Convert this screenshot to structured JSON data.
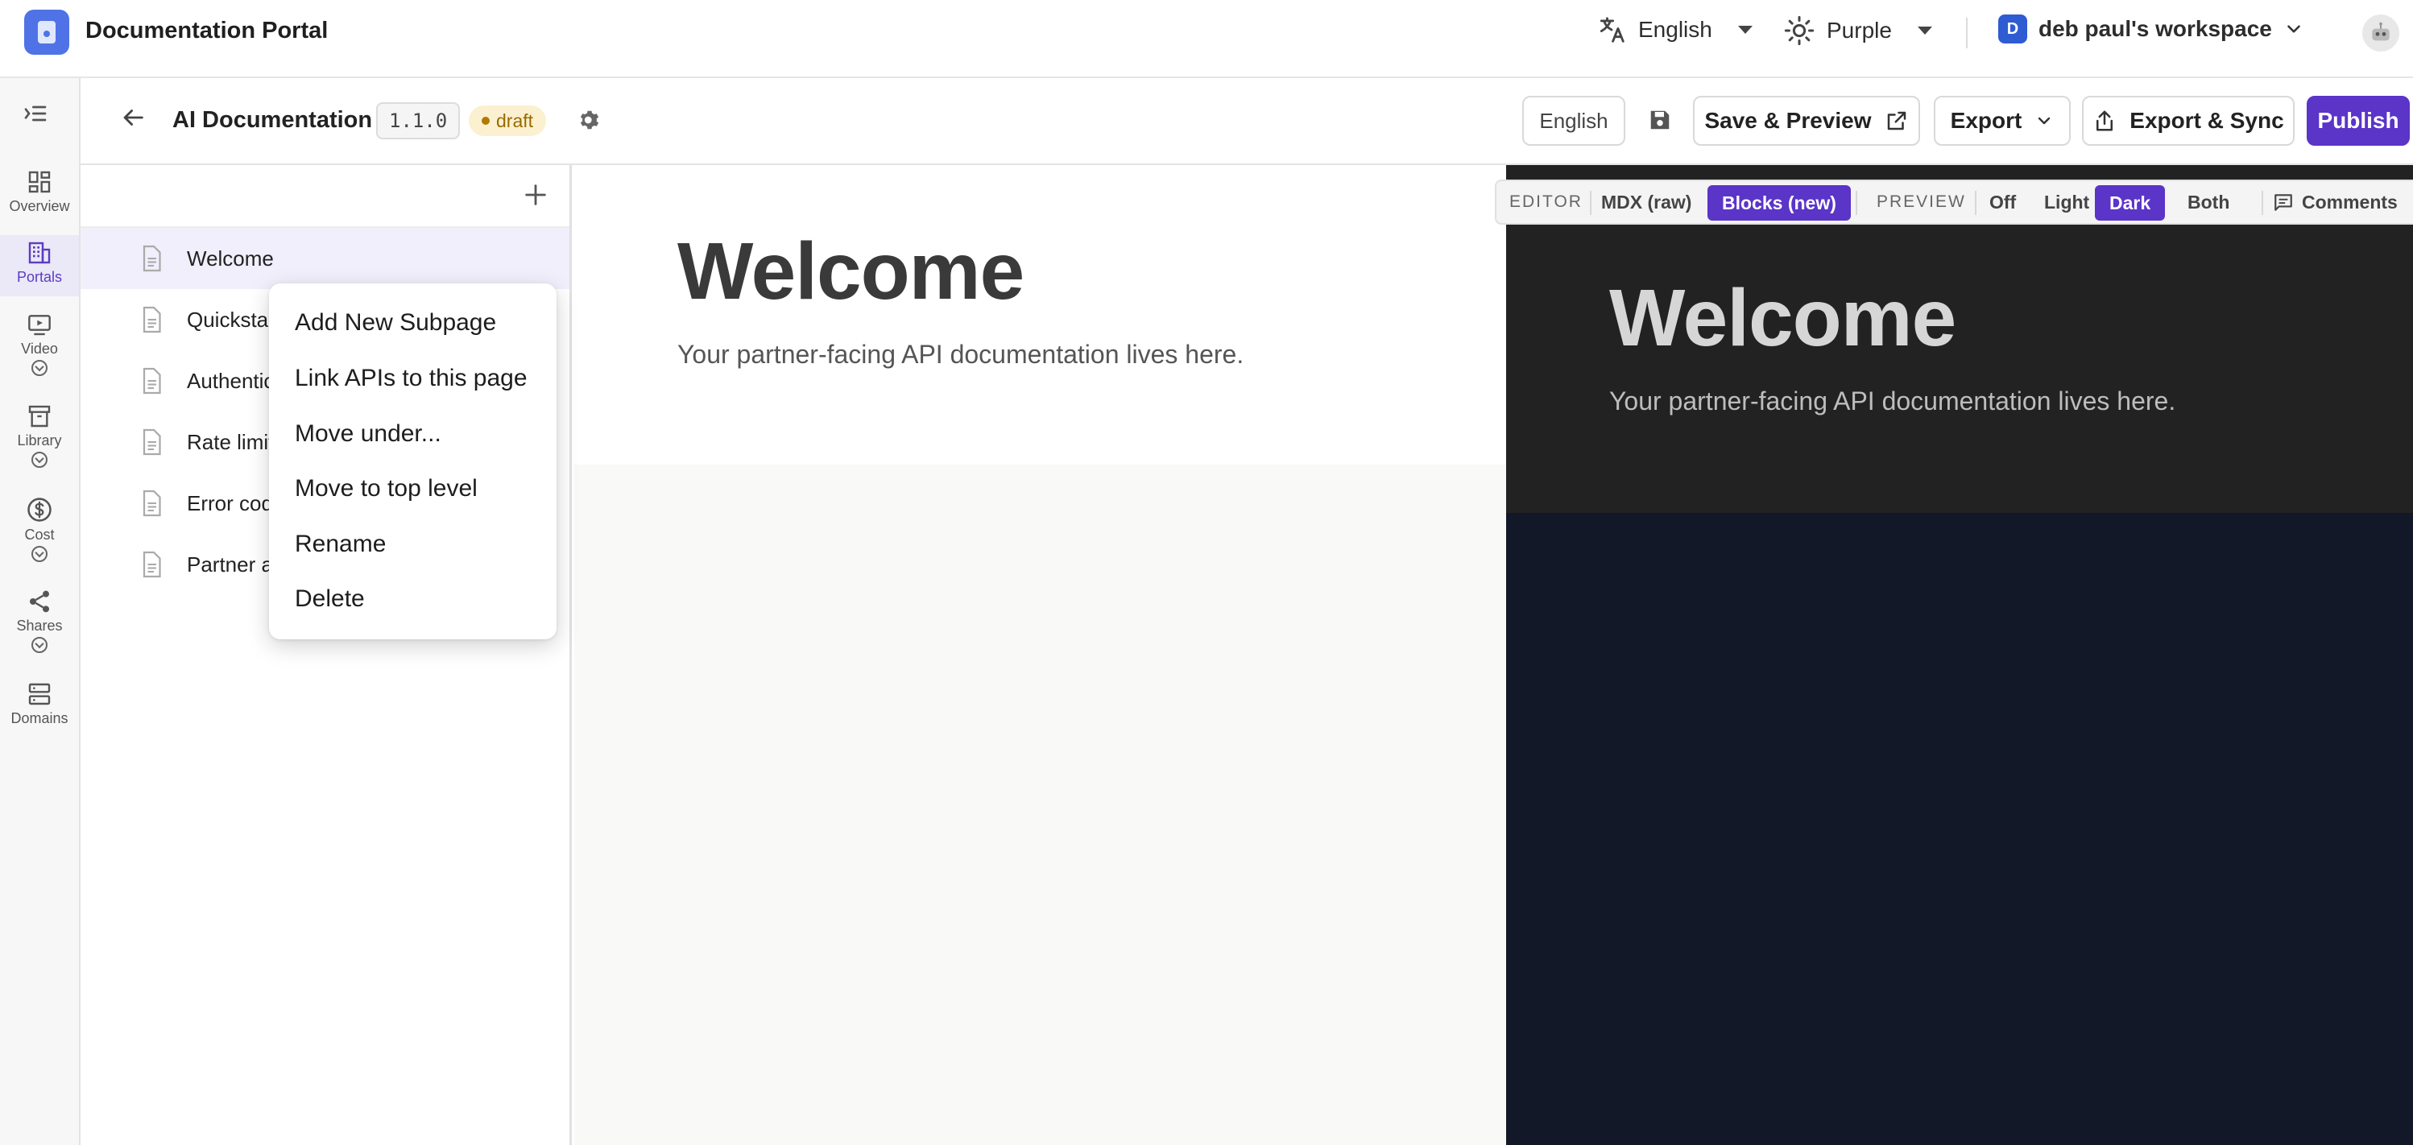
{
  "topbar": {
    "app_title": "Documentation Portal",
    "language": "English",
    "theme": "Purple",
    "workspace_initial": "D",
    "workspace_name": "deb paul's workspace"
  },
  "rail": {
    "items": [
      {
        "label": "Overview",
        "icon": "grid-icon"
      },
      {
        "label": "Portals",
        "icon": "building-icon",
        "active": true
      },
      {
        "label": "Video",
        "icon": "video-icon"
      },
      {
        "label": "Library",
        "icon": "archive-icon"
      },
      {
        "label": "Cost",
        "icon": "dollar-icon"
      },
      {
        "label": "Shares",
        "icon": "share-icon"
      },
      {
        "label": "Domains",
        "icon": "server-icon"
      }
    ]
  },
  "subheader": {
    "title": "AI Documentation",
    "version": "1.1.0",
    "status": "draft",
    "language_button": "English",
    "save_preview": "Save & Preview",
    "export": "Export",
    "export_sync": "Export & Sync",
    "publish": "Publish"
  },
  "tree": {
    "pages": [
      {
        "label": "Welcome",
        "selected": true
      },
      {
        "label": "Quickstart"
      },
      {
        "label": "Authentication"
      },
      {
        "label": "Rate limits"
      },
      {
        "label": "Error codes"
      },
      {
        "label": "Partner access"
      }
    ]
  },
  "context_menu": {
    "items": [
      "Add New Subpage",
      "Link APIs to this page",
      "Move under...",
      "Move to top level",
      "Rename",
      "Delete"
    ]
  },
  "editor": {
    "heading": "Welcome",
    "body": "Your partner-facing API documentation lives here."
  },
  "preview": {
    "heading": "Welcome",
    "body": "Your partner-facing API documentation lives here."
  },
  "modebar": {
    "editor_label": "EDITOR",
    "mdx": "MDX (raw)",
    "blocks": "Blocks (new)",
    "preview_label": "PREVIEW",
    "off": "Off",
    "light": "Light",
    "dark": "Dark",
    "both": "Both",
    "comments": "Comments"
  },
  "colors": {
    "accent": "#5b34c8",
    "preview_bg": "#131829",
    "draft_badge": "#fbf0cf"
  }
}
